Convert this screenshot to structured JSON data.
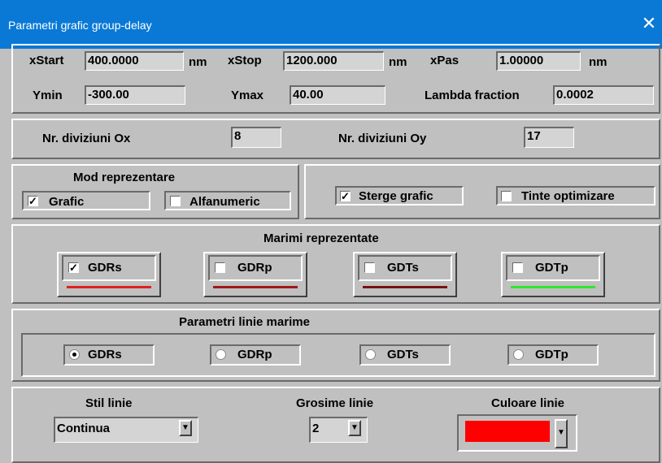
{
  "window": {
    "title": "Parametri grafic group-delay",
    "close_icon": "close-icon"
  },
  "range": {
    "xstart_label": "xStart",
    "xstart_value": "400.0000",
    "xstart_unit": "nm",
    "xstop_label": "xStop",
    "xstop_value": "1200.000",
    "xstop_unit": "nm",
    "xpas_label": "xPas",
    "xpas_value": "1.00000",
    "xpas_unit": "nm",
    "ymin_label": "Ymin",
    "ymin_value": "-300.00",
    "ymax_label": "Ymax",
    "ymax_value": "40.00",
    "lambda_label": "Lambda fraction",
    "lambda_value": "0.0002"
  },
  "divisions": {
    "ox_label": "Nr. diviziuni Ox",
    "ox_value": "8",
    "oy_label": "Nr. diviziuni Oy",
    "oy_value": "17"
  },
  "mode": {
    "title": "Mod reprezentare",
    "grafic_label": "Grafic",
    "grafic_checked": true,
    "alfa_label": "Alfanumeric",
    "alfa_checked": false
  },
  "options": {
    "sterge_label": "Sterge grafic",
    "sterge_checked": true,
    "tinte_label": "Tinte optimizare",
    "tinte_checked": false
  },
  "marimi": {
    "title": "Marimi reprezentate",
    "items": [
      {
        "label": "GDRs",
        "checked": true,
        "color": "#e02020"
      },
      {
        "label": "GDRp",
        "checked": false,
        "color": "#a01818"
      },
      {
        "label": "GDTs",
        "checked": false,
        "color": "#7a1010"
      },
      {
        "label": "GDTp",
        "checked": false,
        "color": "#2ee82e"
      }
    ]
  },
  "linie": {
    "title": "Parametri linie marime",
    "items": [
      {
        "label": "GDRs",
        "selected": true
      },
      {
        "label": "GDRp",
        "selected": false
      },
      {
        "label": "GDTs",
        "selected": false
      },
      {
        "label": "GDTp",
        "selected": false
      }
    ]
  },
  "style": {
    "stil_label": "Stil linie",
    "stil_value": "Continua",
    "grosime_label": "Grosime linie",
    "grosime_value": "2",
    "culoare_label": "Culoare linie",
    "culoare_value": "#ff0000",
    "arrow_icon": "chevron-down-icon"
  }
}
